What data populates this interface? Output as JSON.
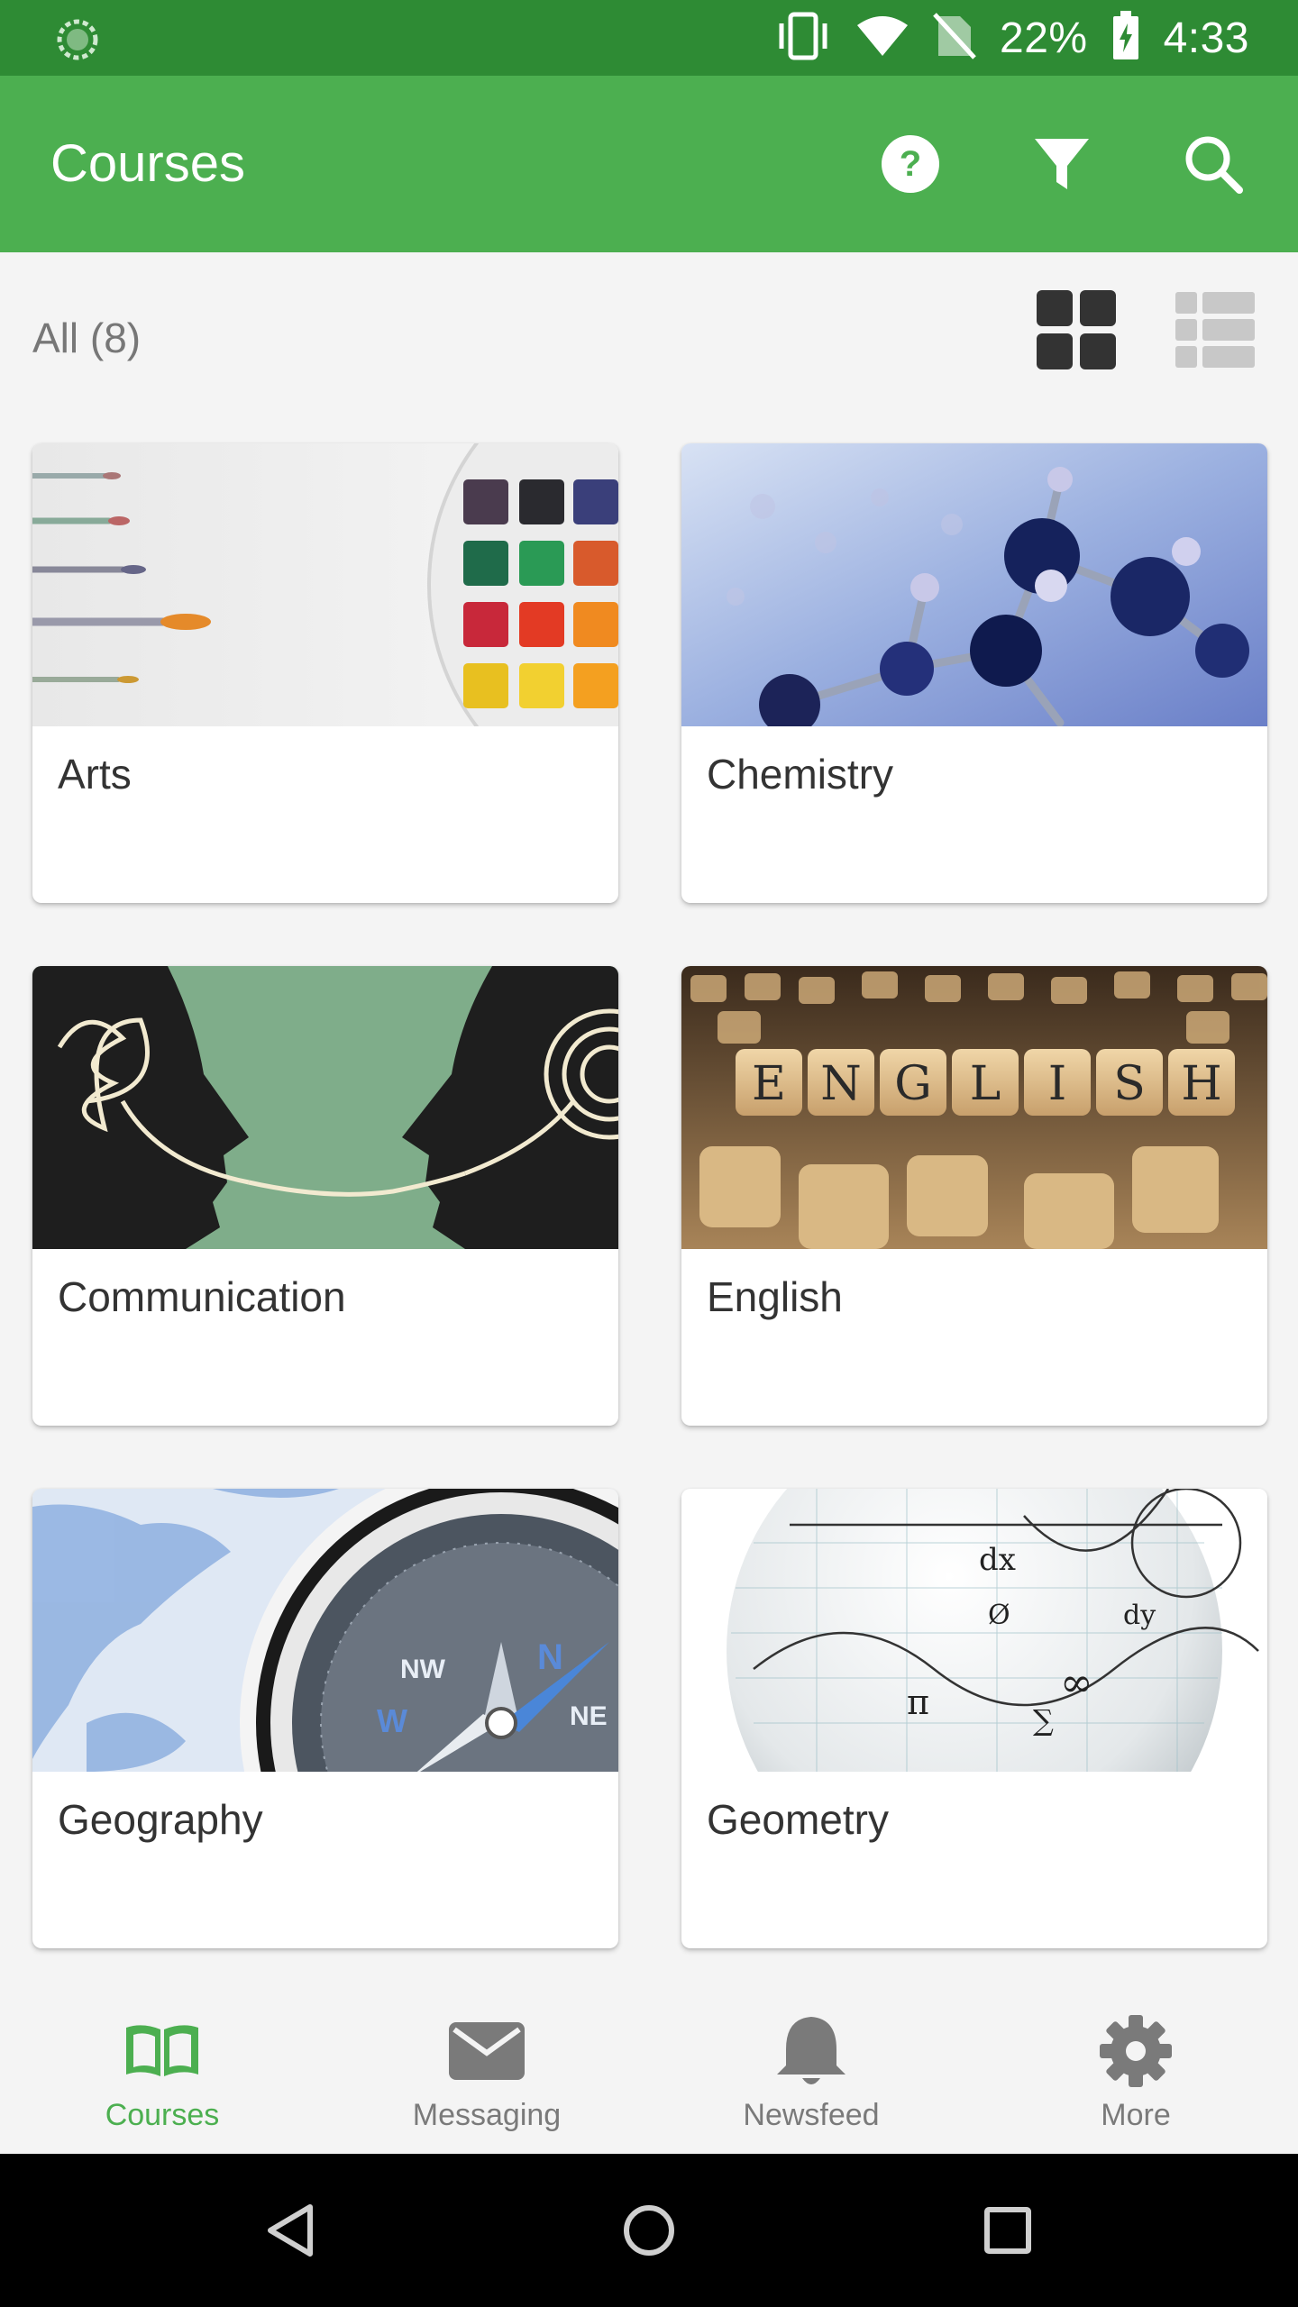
{
  "status_bar": {
    "battery": "22%",
    "time": "4:33",
    "icons": [
      "loading-spinner-icon",
      "vibrate-icon",
      "wifi-icon",
      "no-sim-icon",
      "battery-charging-icon"
    ]
  },
  "app_bar": {
    "title": "Courses",
    "actions": [
      "help-icon",
      "filter-icon",
      "search-icon"
    ]
  },
  "filter": {
    "label": "All (8)",
    "views": [
      "grid-view",
      "list-view"
    ],
    "selected_view": "grid-view"
  },
  "courses": [
    {
      "title": "Arts",
      "thumbnail": "paintbrushes-watercolor-palette"
    },
    {
      "title": "Chemistry",
      "thumbnail": "molecule-model"
    },
    {
      "title": "Communication",
      "thumbnail": "two-heads-talking"
    },
    {
      "title": "English",
      "thumbnail": "english-letter-cubes",
      "thumb_letters": [
        "E",
        "N",
        "G",
        "L",
        "I",
        "S",
        "H"
      ]
    },
    {
      "title": "Geography",
      "thumbnail": "compass-on-map",
      "thumb_letters": [
        "N",
        "W",
        "NW",
        "NE"
      ]
    },
    {
      "title": "Geometry",
      "thumbnail": "math-formula-globe",
      "thumb_letters": [
        "dx",
        "∞",
        "π",
        "∑",
        "Ø",
        "dy"
      ]
    }
  ],
  "bottom_nav": [
    {
      "label": "Courses",
      "icon": "book-icon",
      "active": true
    },
    {
      "label": "Messaging",
      "icon": "envelope-icon",
      "active": false
    },
    {
      "label": "Newsfeed",
      "icon": "bell-icon",
      "active": false
    },
    {
      "label": "More",
      "icon": "gear-icon",
      "active": false
    }
  ],
  "colors": {
    "primary": "#4caf50",
    "primary_dark": "#2e8b34",
    "active_nav": "#4caf50",
    "inactive_nav": "#7a7a7a"
  }
}
